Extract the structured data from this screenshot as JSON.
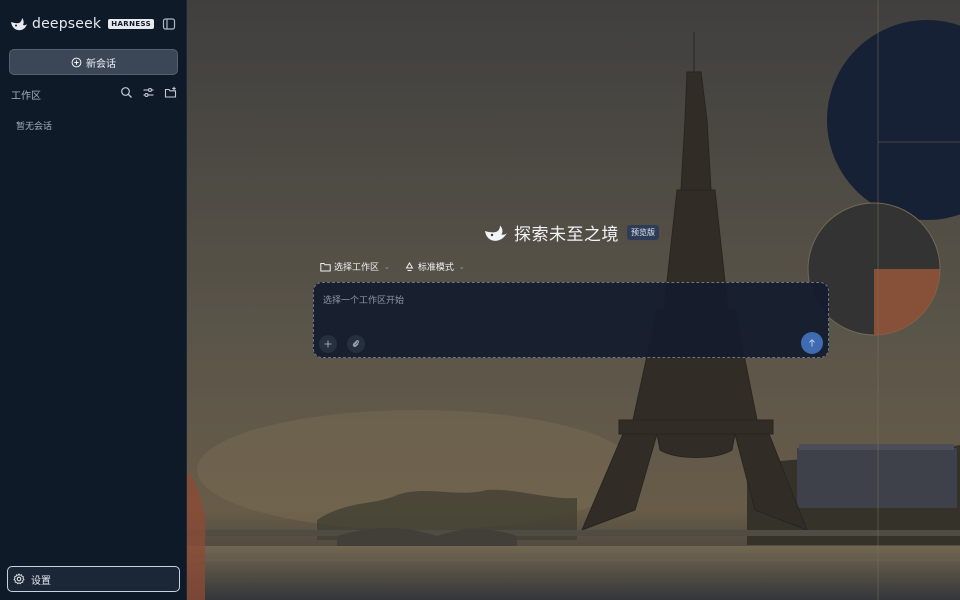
{
  "sidebar": {
    "brand_name": "deepseek",
    "brand_badge": "HARNESS",
    "new_chat_label": "新会话",
    "workspace_label": "工作区",
    "empty_text": "暂无会话",
    "settings_label": "设置"
  },
  "hero": {
    "title": "探索未至之境",
    "badge": "预览版"
  },
  "options": {
    "workspace_select": "选择工作区",
    "mode_select": "标准模式"
  },
  "composer": {
    "placeholder": "选择一个工作区开始"
  },
  "icons": {
    "brand": "whale-logo-icon",
    "sidebar_toggle": "sidebar-toggle-icon",
    "new_chat": "plus-circle-icon",
    "search": "search-icon",
    "filter": "sliders-icon",
    "new_folder": "folder-plus-icon",
    "settings": "gear-icon",
    "workspace": "folder-icon",
    "mode": "recycle-icon",
    "add": "plus-icon",
    "attach": "paperclip-icon",
    "send": "arrow-up-icon"
  },
  "colors": {
    "sidebar_bg": "#0f1a28",
    "accent_send": "#3f6bb3",
    "badge_bg": "#2f3c57"
  }
}
